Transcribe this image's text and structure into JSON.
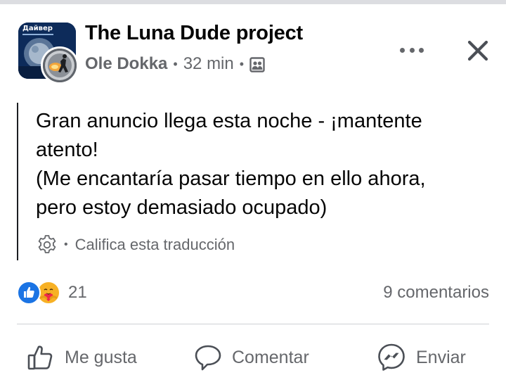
{
  "header": {
    "group_name": "The Luna Dude project",
    "author": "Ole Dokka",
    "time": "32 min",
    "separator": "•",
    "group_avatar_text": "Дайвер",
    "audience_icon": "group-photo-icon",
    "more_icon": "more-horizontal-icon",
    "close_icon": "close-icon"
  },
  "post": {
    "lines": [
      "Gran anuncio llega esta noche - ¡mantente",
      "atento!",
      "(Me encantaría pasar tiempo en ello ahora,",
      "pero estoy demasiado ocupado)"
    ],
    "translation_label": "Califica esta traducción",
    "translation_separator": "•"
  },
  "reactions": {
    "types": [
      "like",
      "care"
    ],
    "count": "21",
    "comments": "9 comentarios"
  },
  "actions": {
    "like": "Me gusta",
    "comment": "Comentar",
    "share": "Enviar"
  },
  "colors": {
    "text": "#050505",
    "secondary": "#65676b",
    "like_blue": "#1b74e4",
    "care_yellow": "#f7b125",
    "divider": "#ced0d4"
  }
}
